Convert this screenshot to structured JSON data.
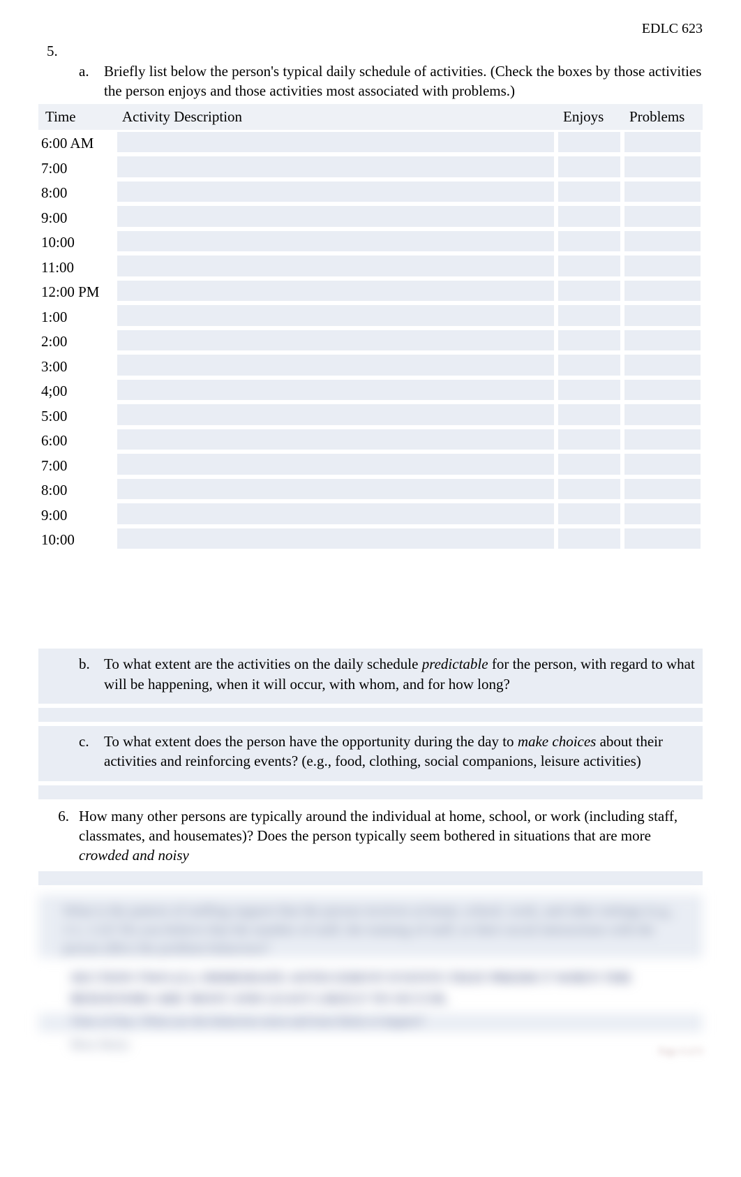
{
  "course_code": "EDLC 623",
  "q5_number": "5.",
  "q5a_letter": "a.",
  "q5a_text": "Briefly list below the person's typical daily schedule of activities. (Check the boxes by those activities the person enjoys and those activities most associated with problems.)",
  "table": {
    "headers": {
      "time": "Time",
      "activity": "Activity Description",
      "enjoys": "Enjoys",
      "problems": "Problems"
    },
    "rows": [
      {
        "time": "6:00 AM",
        "activity": "",
        "enjoys": "",
        "problems": ""
      },
      {
        "time": "7:00",
        "activity": "",
        "enjoys": "",
        "problems": ""
      },
      {
        "time": "8:00",
        "activity": "",
        "enjoys": "",
        "problems": ""
      },
      {
        "time": "9:00",
        "activity": "",
        "enjoys": "",
        "problems": ""
      },
      {
        "time": "10:00",
        "activity": "",
        "enjoys": "",
        "problems": ""
      },
      {
        "time": "11:00",
        "activity": "",
        "enjoys": "",
        "problems": ""
      },
      {
        "time": "12:00 PM",
        "activity": "",
        "enjoys": "",
        "problems": ""
      },
      {
        "time": "1:00",
        "activity": "",
        "enjoys": "",
        "problems": ""
      },
      {
        "time": "2:00",
        "activity": "",
        "enjoys": "",
        "problems": ""
      },
      {
        "time": "3:00",
        "activity": "",
        "enjoys": "",
        "problems": ""
      },
      {
        "time": "4;00",
        "activity": "",
        "enjoys": "",
        "problems": ""
      },
      {
        "time": "5:00",
        "activity": "",
        "enjoys": "",
        "problems": ""
      },
      {
        "time": "6:00",
        "activity": "",
        "enjoys": "",
        "problems": ""
      },
      {
        "time": "7:00",
        "activity": "",
        "enjoys": "",
        "problems": ""
      },
      {
        "time": "8:00",
        "activity": "",
        "enjoys": "",
        "problems": ""
      },
      {
        "time": "9:00",
        "activity": "",
        "enjoys": "",
        "problems": ""
      },
      {
        "time": "10:00",
        "activity": "",
        "enjoys": "",
        "problems": ""
      }
    ]
  },
  "q5b_letter": "b.",
  "q5b_prefix": " To what extent are the activities on the daily schedule ",
  "q5b_ital": "predictable",
  "q5b_suffix": " for the person, with regard to what will be happening, when it will occur, with whom, and for how long?",
  "q5c_letter": "c.",
  "q5c_prefix": " To what extent does the person have the opportunity during the day to ",
  "q5c_ital": "make choices",
  "q5c_suffix": " about their activities and reinforcing events? (e.g., food, clothing, social companions, leisure activities)",
  "q6_number": "6.",
  "q6_prefix": " How many other persons are typically around the individual at home, school, or work (including staff, classmates, and housemates)? Does the person typically seem bothered in situations that are more ",
  "q6_ital": "crowded and noisy",
  "blur_text1": "What is the pattern of staffing support that the person receives at home, school, work, and other settings (e.g., 1:1, 1:2)? Do you believe that the number of staff, the training of staff, or their social interactions with the person affect the problem behaviors?",
  "blur_heading": "SECTION TWO (C):  IMMEDIATE  ANTECEDENT EVENTS  THAT PREDICT  WHEN  THE BEHAVIORS ARE  MOST AND LEAST LIKELY TO OCCUR.",
  "blur_line1": "Time of Day:  When are the behaviors most and least likely to happen?",
  "blur_line2": "Most likely:",
  "page_label": "Page 4 of 9"
}
